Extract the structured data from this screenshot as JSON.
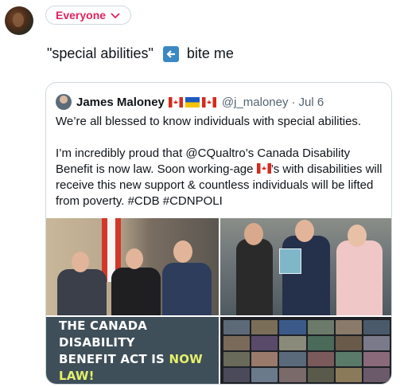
{
  "compose": {
    "audience_label": "Everyone",
    "text_before": "\"special abilities\"",
    "emoji_label": "back-arrow-emoji",
    "text_after": "bite me"
  },
  "quoted_tweet": {
    "author_name": "James Maloney",
    "handle": "@j_maloney",
    "separator": "·",
    "date": "Jul 6",
    "paragraph1": "We’re all blessed to know individuals with special abilities.",
    "paragraph2_part1": "I’m incredibly proud that @CQualtro’s Canada Disability Benefit is now law. Soon working-age ",
    "paragraph2_part2": "’s with disabilities will receive this new support & countless individuals will be lifted from poverty. #CDB #CDNPOLI"
  },
  "media": {
    "banner_line1": "THE CANADA DISABILITY",
    "banner_line2_a": "BENEFIT ACT IS ",
    "banner_line2_b": "NOW LAW!"
  },
  "colors": {
    "accent": "#e0245e",
    "border": "#cfd9de",
    "secondary_text": "#536471",
    "banner_bg": "#3f4f59",
    "banner_highlight": "#e4f06a"
  }
}
